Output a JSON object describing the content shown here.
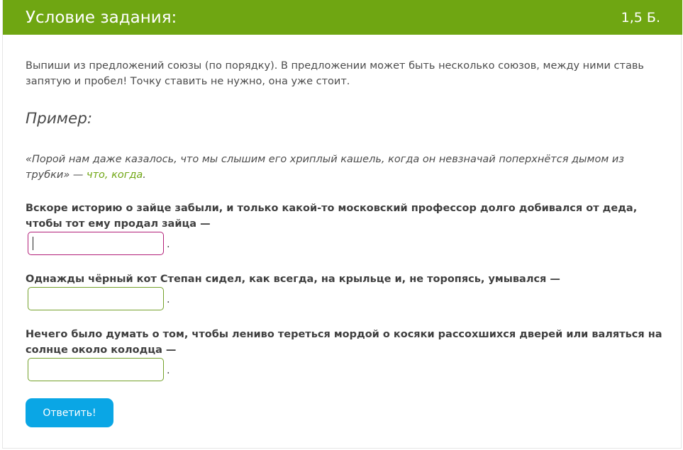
{
  "header": {
    "title": "Условие задания:",
    "points": "1,5 Б."
  },
  "instruction": "Выпиши из предложений союзы (по порядку). В предложении может быть несколько союзов, между ними ставь запятую и пробел! Точку ставить не нужно, она уже стоит.",
  "example": {
    "heading": "Пример:",
    "sentence": "«Порой нам даже казалось, что мы слышим его хриплый кашель, когда он невзначай поперхнётся дымом из трубки» — ",
    "answer": "что, когда",
    "end": "."
  },
  "tasks": [
    {
      "sentence": "Вскоре историю о зайце забыли, и только какой-то московский профессор долго добивался от деда, чтобы тот ему продал зайца —",
      "value": "",
      "suffix": "."
    },
    {
      "sentence": "Однажды чёрный кот Степан сидел, как всегда, на крыльце и, не торопясь, умывался —",
      "value": "",
      "suffix": "."
    },
    {
      "sentence": "Нечего было думать о том, чтобы лениво тереться мордой о косяки рассохшихся дверей или валяться на солнце около колодца —",
      "value": "",
      "suffix": "."
    }
  ],
  "submit_label": "Ответить!",
  "colors": {
    "header": "#6fa612",
    "input_border": "#74a12a",
    "focused_border": "#b21f78",
    "button": "#0aa6e5"
  }
}
